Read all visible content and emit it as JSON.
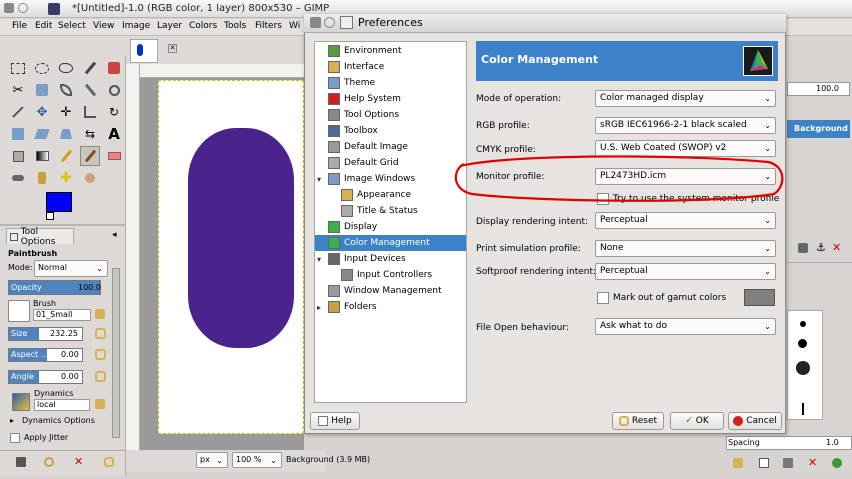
{
  "gimp": {
    "title": "*[Untitled]-1.0 (RGB color, 1 layer) 800x530 – GIMP",
    "menus": [
      "File",
      "Edit",
      "Select",
      "View",
      "Image",
      "Layer",
      "Colors",
      "Tools",
      "Filters",
      "Wi"
    ],
    "tool_options_tab": "Tool Options",
    "paintbrush_label": "Paintbrush",
    "mode_label": "Mode:",
    "mode_value": "Normal",
    "opacity_label": "Opacity",
    "opacity_value": "100.0",
    "brush_label": "Brush",
    "brush_value": "01_Small",
    "size_label": "Size",
    "size_value": "232.25",
    "aspect_label": "Aspect ...",
    "aspect_value": "0.00",
    "angle_label": "Angle",
    "angle_value": "0.00",
    "dynamics_label": "Dynamics",
    "dynamics_value": "local",
    "dynamics_options": "Dynamics Options",
    "apply_jitter": "Apply Jitter",
    "status_unit": "px",
    "status_zoom": "100 %",
    "status_text": "Background (3.9 MB)",
    "layer_name": "Background",
    "layer_opacity": "100.0",
    "spacing_label": "Spacing",
    "spacing_value": "1.0"
  },
  "dialog": {
    "title": "Preferences",
    "header": "Color Management",
    "tree": [
      {
        "label": "Environment",
        "indent": 0
      },
      {
        "label": "Interface",
        "indent": 0
      },
      {
        "label": "Theme",
        "indent": 0
      },
      {
        "label": "Help System",
        "indent": 0
      },
      {
        "label": "Tool Options",
        "indent": 0
      },
      {
        "label": "Toolbox",
        "indent": 0
      },
      {
        "label": "Default Image",
        "indent": 0
      },
      {
        "label": "Default Grid",
        "indent": 0
      },
      {
        "label": "Image Windows",
        "indent": 0,
        "expanded": true
      },
      {
        "label": "Appearance",
        "indent": 1
      },
      {
        "label": "Title & Status",
        "indent": 1
      },
      {
        "label": "Display",
        "indent": 0
      },
      {
        "label": "Color Management",
        "indent": 0,
        "selected": true
      },
      {
        "label": "Input Devices",
        "indent": 0,
        "expanded": true
      },
      {
        "label": "Input Controllers",
        "indent": 1
      },
      {
        "label": "Window Management",
        "indent": 0
      },
      {
        "label": "Folders",
        "indent": 0,
        "collapsed": true
      }
    ],
    "fields": {
      "mode_label": "Mode of operation:",
      "mode_value": "Color managed display",
      "rgb_label": "RGB profile:",
      "rgb_value": "sRGB IEC61966-2-1 black scaled",
      "cmyk_label": "CMYK profile:",
      "cmyk_value": "U.S. Web Coated (SWOP) v2",
      "monitor_label": "Monitor profile:",
      "monitor_value": "PL2473HD.icm",
      "system_monitor_label": "Try to use the system monitor profile",
      "display_intent_label": "Display rendering intent:",
      "display_intent_value": "Perceptual",
      "print_sim_label": "Print simulation profile:",
      "print_sim_value": "None",
      "softproof_label": "Softproof rendering intent:",
      "softproof_value": "Perceptual",
      "gamut_label": "Mark out of gamut colors",
      "file_open_label": "File Open behaviour:",
      "file_open_value": "Ask what to do"
    },
    "buttons": {
      "help": "Help",
      "reset": "Reset",
      "ok": "OK",
      "cancel": "Cancel"
    }
  },
  "colors": {
    "accent": "#3d82c8",
    "shape": "#4b238c",
    "annotation": "#e00000",
    "foreground": "#0000ff",
    "gamut_swatch": "#808080"
  }
}
